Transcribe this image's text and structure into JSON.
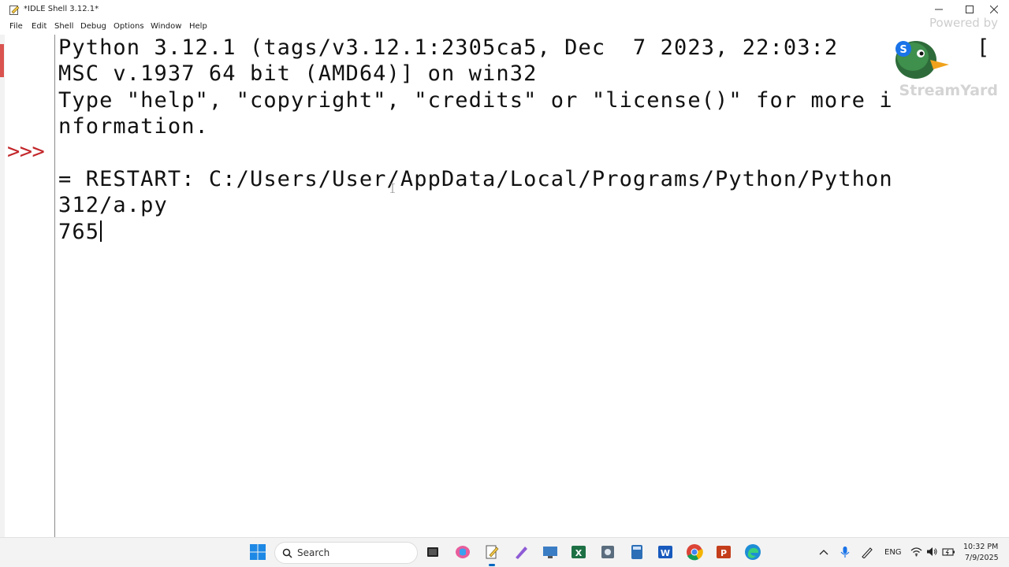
{
  "window": {
    "title": "*IDLE Shell 3.12.1*"
  },
  "menu": [
    "File",
    "Edit",
    "Shell",
    "Debug",
    "Options",
    "Window",
    "Help"
  ],
  "shell": {
    "prompt": ">>>",
    "lines": [
      "Python 3.12.1 (tags/v3.12.1:2305ca5, Dec  7 2023, 22:03:2",
      "MSC v.1937 64 bit (AMD64)] on win32",
      "Type \"help\", \"copyright\", \"credits\" or \"license()\" for more i",
      "nformation.",
      "",
      "= RESTART: C:/Users/User/AppData/Local/Programs/Python/Python",
      "312/a.py",
      "765"
    ],
    "line1_tail": "["
  },
  "watermark": {
    "powered": "Powered by",
    "brand": "StreamYard"
  },
  "taskbar": {
    "search_placeholder": "Search",
    "tray": {
      "language": "ENG",
      "time": "10:32 PM",
      "date": "7/9/2025"
    }
  },
  "colors": {
    "prompt": "#c3272b",
    "taskbar": "#f3f3f3",
    "accent": "#0067c0"
  }
}
